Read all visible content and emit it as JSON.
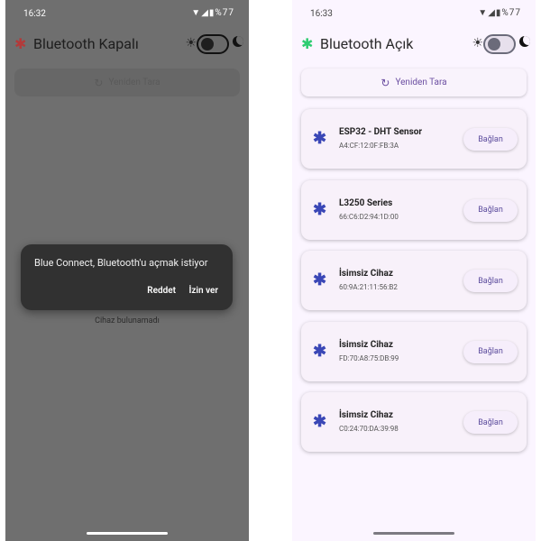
{
  "left_screen": {
    "status_time": "16:32",
    "status_battery": "%77",
    "app_title": "Bluetooth Kapalı",
    "rescan_label": "Yeniden Tara",
    "empty_message": "Cihaz bulunamadı",
    "dialog": {
      "message": "Blue Connect, Bluetooth'u açmak istiyor",
      "deny_label": "Reddet",
      "allow_label": "İzin ver"
    }
  },
  "right_screen": {
    "status_time": "16:33",
    "status_battery": "%77",
    "app_title": "Bluetooth Açık",
    "rescan_label": "Yeniden Tara",
    "devices": [
      {
        "name": "ESP32 - DHT Sensor",
        "address": "A4:CF:12:0F:FB:3A",
        "button": "Bağlan"
      },
      {
        "name": "L3250 Series",
        "address": "66:C6:D2:94:1D:00",
        "button": "Bağlan"
      },
      {
        "name": "İsimsiz Cihaz",
        "address": "60:9A:21:11:56:B2",
        "button": "Bağlan"
      },
      {
        "name": "İsimsiz Cihaz",
        "address": "FD:70:A8:75:DB:99",
        "button": "Bağlan"
      },
      {
        "name": "İsimsiz Cihaz",
        "address": "C0:24:70:DA:39:98",
        "button": "Bağlan"
      }
    ]
  },
  "icons": {
    "bluetooth_off": "bluetooth-disabled-icon",
    "bluetooth_on": "bluetooth-icon",
    "theme_light": "sun-icon",
    "theme_dark": "moon-icon",
    "refresh": "refresh-icon"
  },
  "colors": {
    "bluetooth_off": "#c0392b",
    "bluetooth_on": "#2ecc71",
    "device_icon": "#3a47b6",
    "accent": "#6b4ea1"
  }
}
